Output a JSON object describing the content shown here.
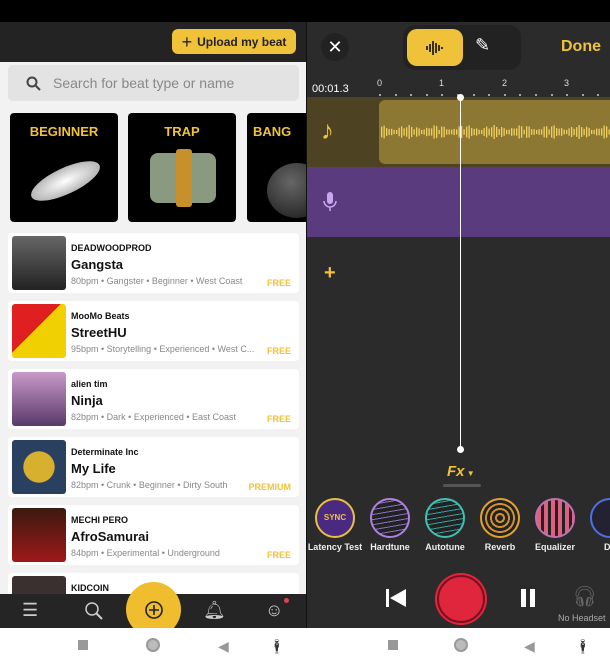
{
  "left": {
    "upload_label": "Upload my beat",
    "search_placeholder": "Search for beat type or name",
    "categories": [
      "BEGINNER",
      "TRAP",
      "BANG"
    ],
    "beats": [
      {
        "artist": "DEADWOODPROD",
        "title": "Gangsta",
        "meta": "80bpm • Gangster • Beginner • West Coast",
        "price": "FREE"
      },
      {
        "artist": "MooMo Beats",
        "title": "StreetHU",
        "meta": "95bpm • Storytelling • Experienced • West C...",
        "price": "FREE"
      },
      {
        "artist": "alien tim",
        "title": "Ninja",
        "meta": "82bpm • Dark • Experienced • East Coast",
        "price": "FREE"
      },
      {
        "artist": "Determinate Inc",
        "title": "My Life",
        "meta": "82bpm • Crunk • Beginner • Dirty South",
        "price": "PREMIUM"
      },
      {
        "artist": "MECHI PERO",
        "title": "AfroSamurai",
        "meta": "84bpm • Experimental • Underground",
        "price": "FREE"
      },
      {
        "artist": "KIDCOIN",
        "title": "",
        "meta": "",
        "price": ""
      }
    ],
    "nav": [
      "menu-icon",
      "search-icon",
      "add-circle-icon",
      "bell-icon",
      "profile-icon"
    ]
  },
  "right": {
    "done_label": "Done",
    "time": "00:01.3",
    "ticks": [
      "0",
      "1",
      "2",
      "3"
    ],
    "fx_label": "Fx",
    "effects": [
      "Latency Test",
      "Hardtune",
      "Autotune",
      "Reverb",
      "Equalizer",
      "Du"
    ],
    "headset_label": "No Headset"
  },
  "colors": {
    "accent": "#f0c23a",
    "record": "#e0263c",
    "mic_track": "#5a3c7e"
  }
}
